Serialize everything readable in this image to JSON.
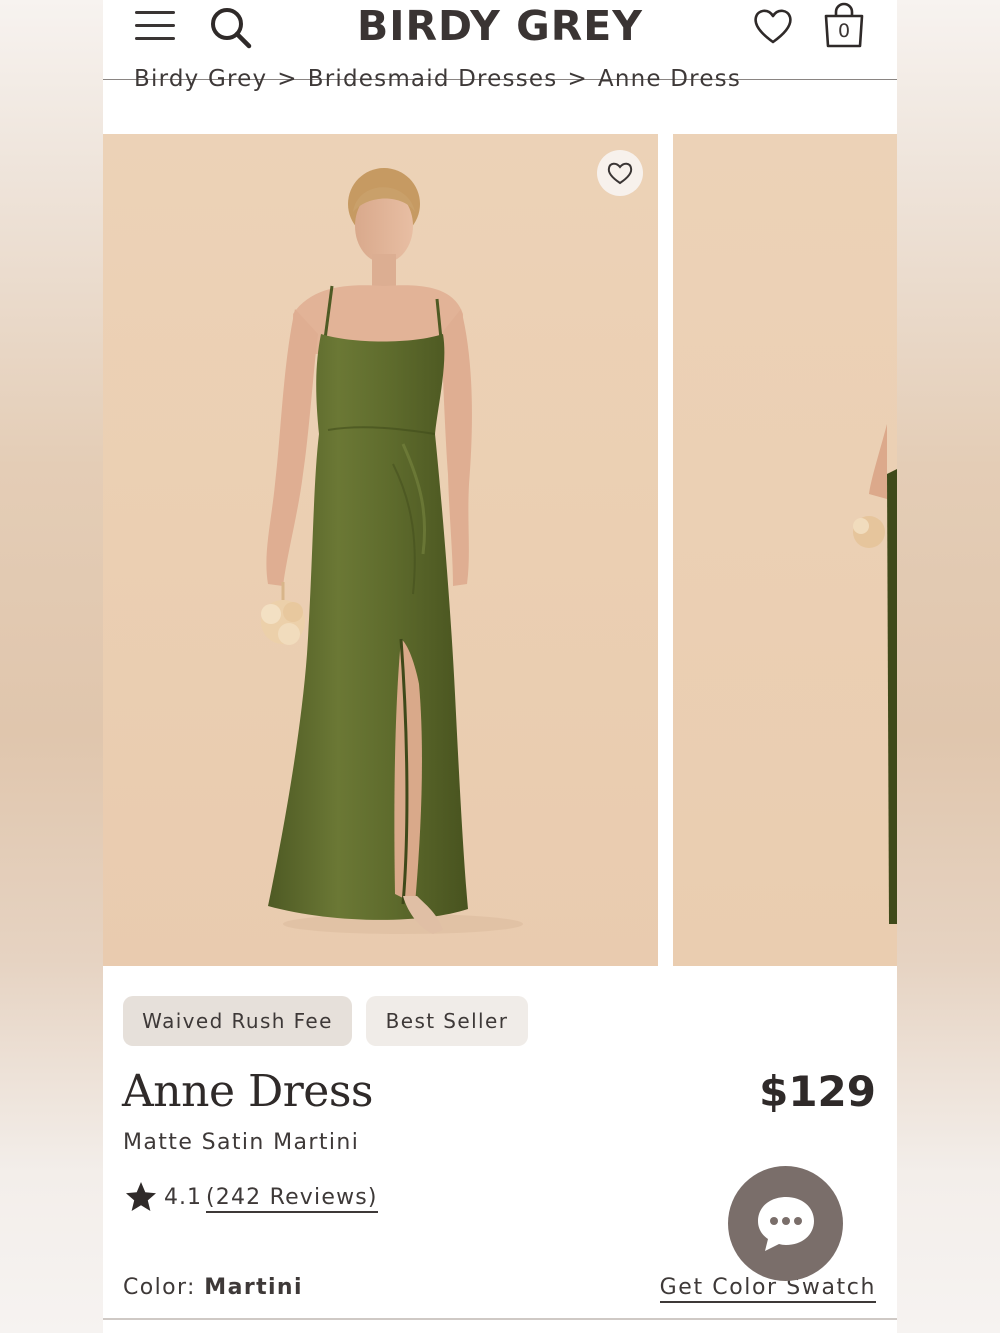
{
  "header": {
    "logo": "BIRDY GREY",
    "cart_count": "0",
    "icons": [
      "hamburger-menu-icon",
      "search-icon",
      "heart-icon",
      "shopping-bag-icon"
    ]
  },
  "breadcrumb": {
    "items": [
      "Birdy Grey",
      "Bridesmaid Dresses",
      "Anne Dress"
    ],
    "separator": ">"
  },
  "gallery": {
    "background_color": "#ecd3b9",
    "dress_color": "#5e6b2e"
  },
  "badges": [
    "Waived Rush Fee",
    "Best Seller"
  ],
  "product": {
    "name": "Anne Dress",
    "price": "$129",
    "variant": "Matte Satin Martini",
    "rating": "4.1",
    "reviews": "(242 Reviews)"
  },
  "color": {
    "label": "Color:",
    "value": "Martini",
    "swatch_link": "Get Color Swatch"
  },
  "colors": {
    "text": "#3e3938",
    "chat_button": "#7a6e6a"
  }
}
